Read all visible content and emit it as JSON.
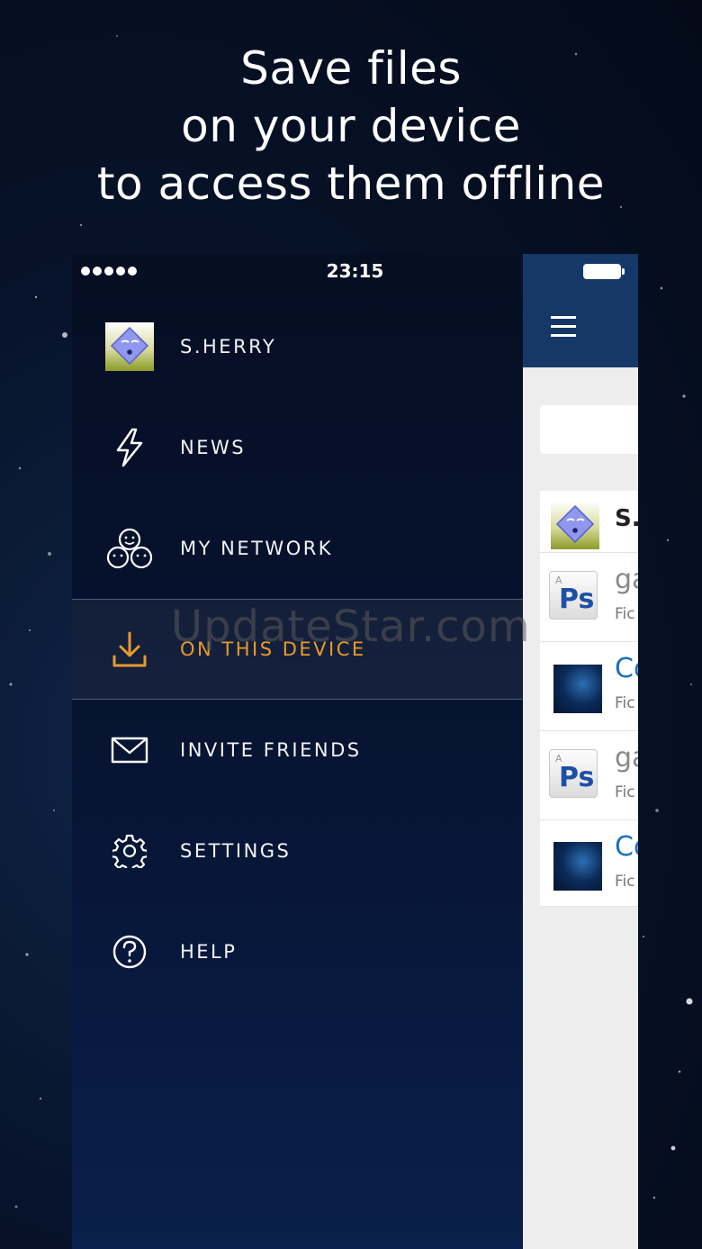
{
  "headline": {
    "line1": "Save files",
    "line2": "on your device",
    "line3": "to access them offline"
  },
  "status_bar": {
    "time": "23:15",
    "signal_dots": 5
  },
  "menu": {
    "items": [
      {
        "label": "S.HERRY",
        "icon": "avatar",
        "active": false
      },
      {
        "label": "NEWS",
        "icon": "lightning-icon",
        "active": false
      },
      {
        "label": "MY NETWORK",
        "icon": "network-icon",
        "active": false
      },
      {
        "label": "ON THIS DEVICE",
        "icon": "download-icon",
        "active": true
      },
      {
        "label": "INVITE FRIENDS",
        "icon": "envelope-icon",
        "active": false
      },
      {
        "label": "SETTINGS",
        "icon": "gear-icon",
        "active": false
      },
      {
        "label": "HELP",
        "icon": "help-icon",
        "active": false
      }
    ]
  },
  "feed": {
    "profile_title": "S.",
    "files": [
      {
        "title": "ga",
        "subtitle": "Fic",
        "thumb": "photoshop",
        "title_color": "#888888"
      },
      {
        "title": "Co",
        "subtitle": "Fic",
        "thumb": "space",
        "title_color": "#1d6fc0"
      },
      {
        "title": "ga",
        "subtitle": "Fic",
        "thumb": "photoshop",
        "title_color": "#888888"
      },
      {
        "title": "Co",
        "subtitle": "Fic",
        "thumb": "space",
        "title_color": "#1d6fc0"
      }
    ]
  },
  "thumb_text": {
    "ps": "Ps",
    "adobe": "A"
  },
  "watermark": "UpdateStar.com",
  "colors": {
    "accent": "#e89a2c",
    "topbar": "#163868",
    "menu_bg": "#071534"
  }
}
